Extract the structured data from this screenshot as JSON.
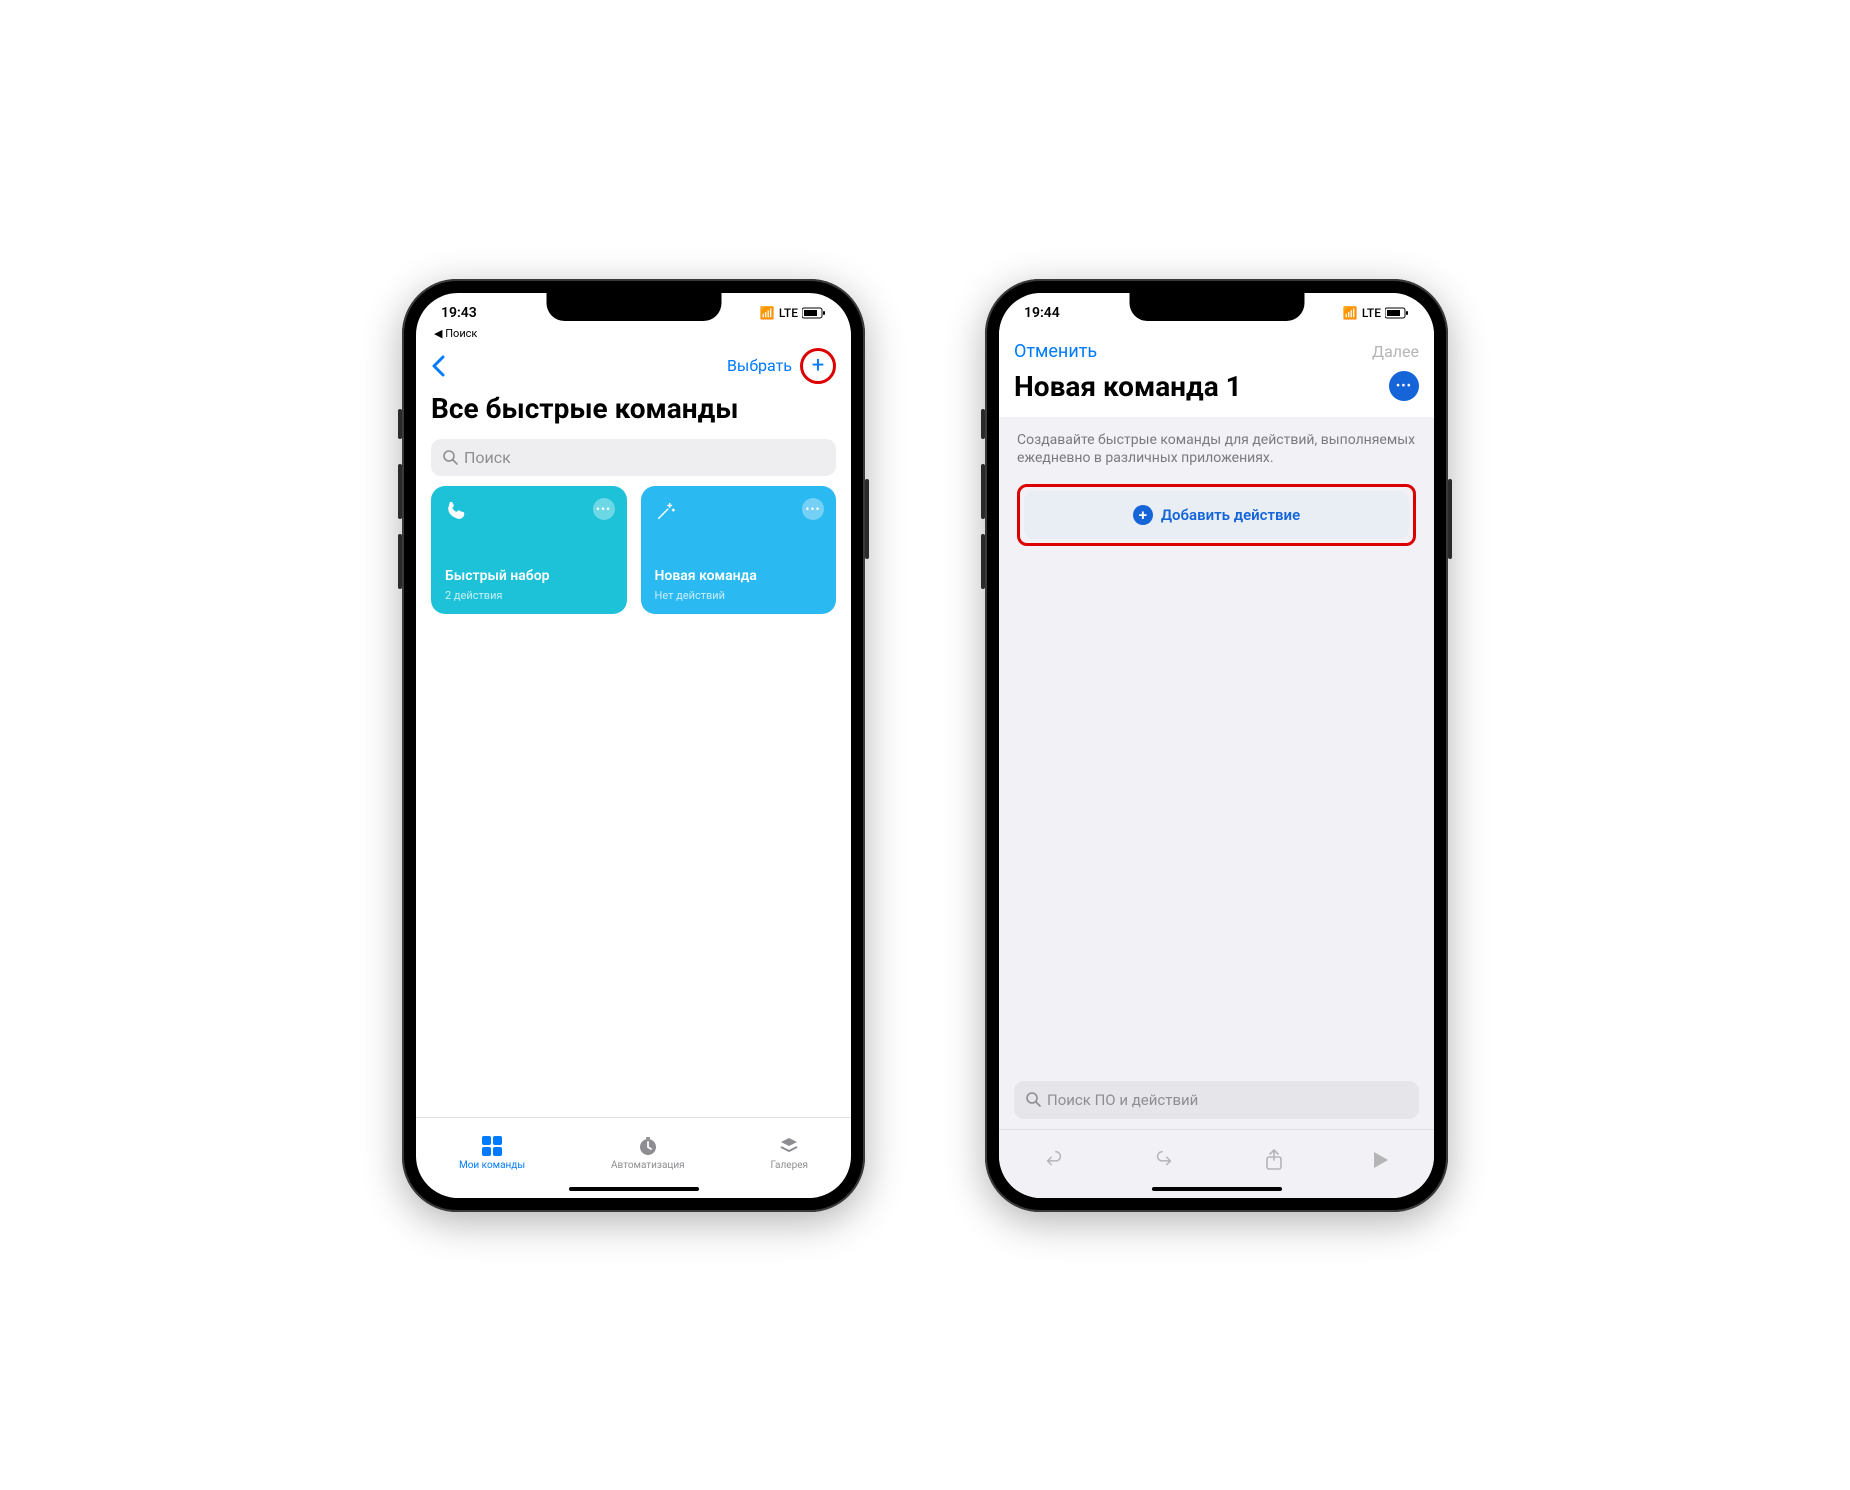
{
  "phone1": {
    "status": {
      "time": "19:43",
      "network": "LTE",
      "back_label": "Поиск"
    },
    "nav": {
      "select_label": "Выбрать"
    },
    "title": "Все быстрые команды",
    "search_placeholder": "Поиск",
    "tiles": [
      {
        "title": "Быстрый набор",
        "subtitle": "2 действия"
      },
      {
        "title": "Новая команда",
        "subtitle": "Нет действий"
      }
    ],
    "tabs": [
      {
        "label": "Мои команды"
      },
      {
        "label": "Автоматизация"
      },
      {
        "label": "Галерея"
      }
    ]
  },
  "phone2": {
    "status": {
      "time": "19:44",
      "network": "LTE"
    },
    "nav": {
      "cancel_label": "Отменить",
      "next_label": "Далее"
    },
    "title": "Новая команда 1",
    "description": "Создавайте быстрые команды для действий, выполняемых ежедневно в различных приложениях.",
    "add_action_label": "Добавить действие",
    "search_placeholder": "Поиск ПО и действий"
  }
}
